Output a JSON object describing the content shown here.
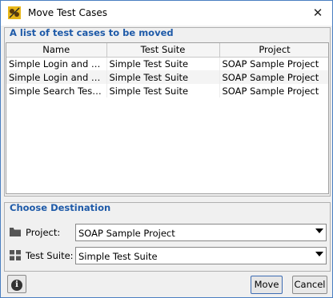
{
  "window": {
    "title": "Move Test Cases",
    "close_glyph": "✕"
  },
  "list_group": {
    "title": "A list of test cases to be moved",
    "columns": [
      "Name",
      "Test Suite",
      "Project"
    ],
    "rows": [
      {
        "name": "Simple Login and Lo...",
        "suite": "Simple Test Suite",
        "project": "SOAP Sample Project"
      },
      {
        "name": "Simple Login and Lo...",
        "suite": "Simple Test Suite",
        "project": "SOAP Sample Project"
      },
      {
        "name": "Simple Search TestCa...",
        "suite": "Simple Test Suite",
        "project": "SOAP Sample Project"
      }
    ]
  },
  "destination": {
    "title": "Choose Destination",
    "project_label": "Project:",
    "project_value": "SOAP Sample Project",
    "suite_label": "Test Suite:",
    "suite_value": "Simple Test Suite"
  },
  "buttons": {
    "info": "i",
    "move": "Move",
    "cancel": "Cancel"
  },
  "colors": {
    "accent": "#1e5aa8",
    "border": "#4a7fc1"
  }
}
